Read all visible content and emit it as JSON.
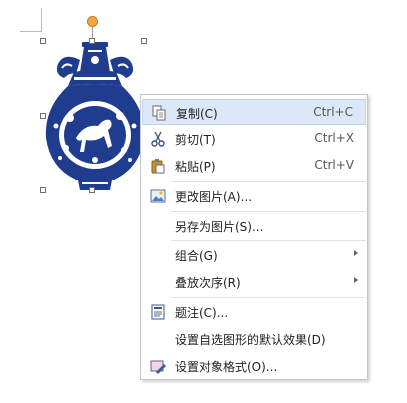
{
  "context_menu": {
    "items": [
      {
        "label": "复制(C)",
        "shortcut": "Ctrl+C",
        "icon": "copy-icon"
      },
      {
        "label": "剪切(T)",
        "shortcut": "Ctrl+X",
        "icon": "scissors-icon"
      },
      {
        "label": "粘贴(P)",
        "shortcut": "Ctrl+V",
        "icon": "paste-icon"
      },
      {
        "label": "更改图片(A)...",
        "icon": "change-picture-icon"
      },
      {
        "label": "另存为图片(S)..."
      },
      {
        "label": "组合(G)",
        "submenu": true
      },
      {
        "label": "叠放次序(R)",
        "submenu": true
      },
      {
        "label": "题注(C)...",
        "icon": "caption-icon"
      },
      {
        "label": "设置自选图形的默认效果(D)"
      },
      {
        "label": "设置对象格式(O)...",
        "icon": "format-object-icon"
      }
    ]
  },
  "colors": {
    "menu_highlight": "#dce7f7",
    "porcelain_blue": "#1f3c8f",
    "rotate_handle": "#f4a640"
  }
}
